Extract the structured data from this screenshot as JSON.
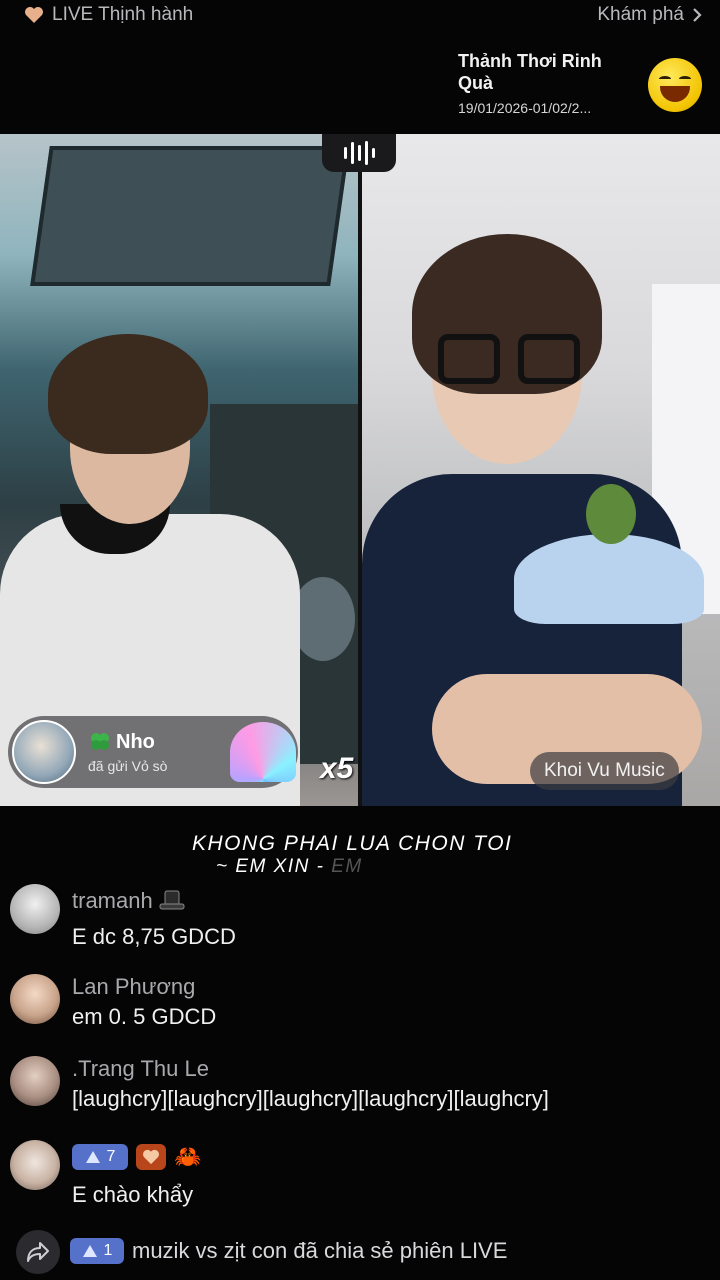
{
  "topbar": {
    "live_tab": "LIVE Thịnh hành",
    "explore": "Khám phá",
    "promo_title": "Thảnh Thơi Rinh Quà",
    "promo_date": "19/01/2026-01/02/2..."
  },
  "gift": {
    "sender_name": "Nho",
    "message": "đã gửi Vỏ sò",
    "multiplier": "x5"
  },
  "guest_name": "Khoi Vu Music",
  "lyric": {
    "line1": "KHONG PHAI LUA CHON TOI",
    "line2": "~ EM XIN -",
    "line2_fade": "EM"
  },
  "comments": [
    {
      "user": "tramanh",
      "text": "E dc 8,75 GDCD"
    },
    {
      "user": "Lan Phương",
      "text": "em 0. 5 GDCD"
    },
    {
      "user": ".Trang Thu Le",
      "text": "[laughcry][laughcry][laughcry][laughcry][laughcry]"
    },
    {
      "badge_level": "7",
      "text": "E chào khẩy"
    }
  ],
  "share": {
    "badge_level": "1",
    "text": "muzik vs zịt con đã chia sẻ phiên LIVE"
  },
  "colors": {
    "badge_blue": "#5571c9",
    "badge_orange": "#b8461a",
    "background": "#050506"
  }
}
